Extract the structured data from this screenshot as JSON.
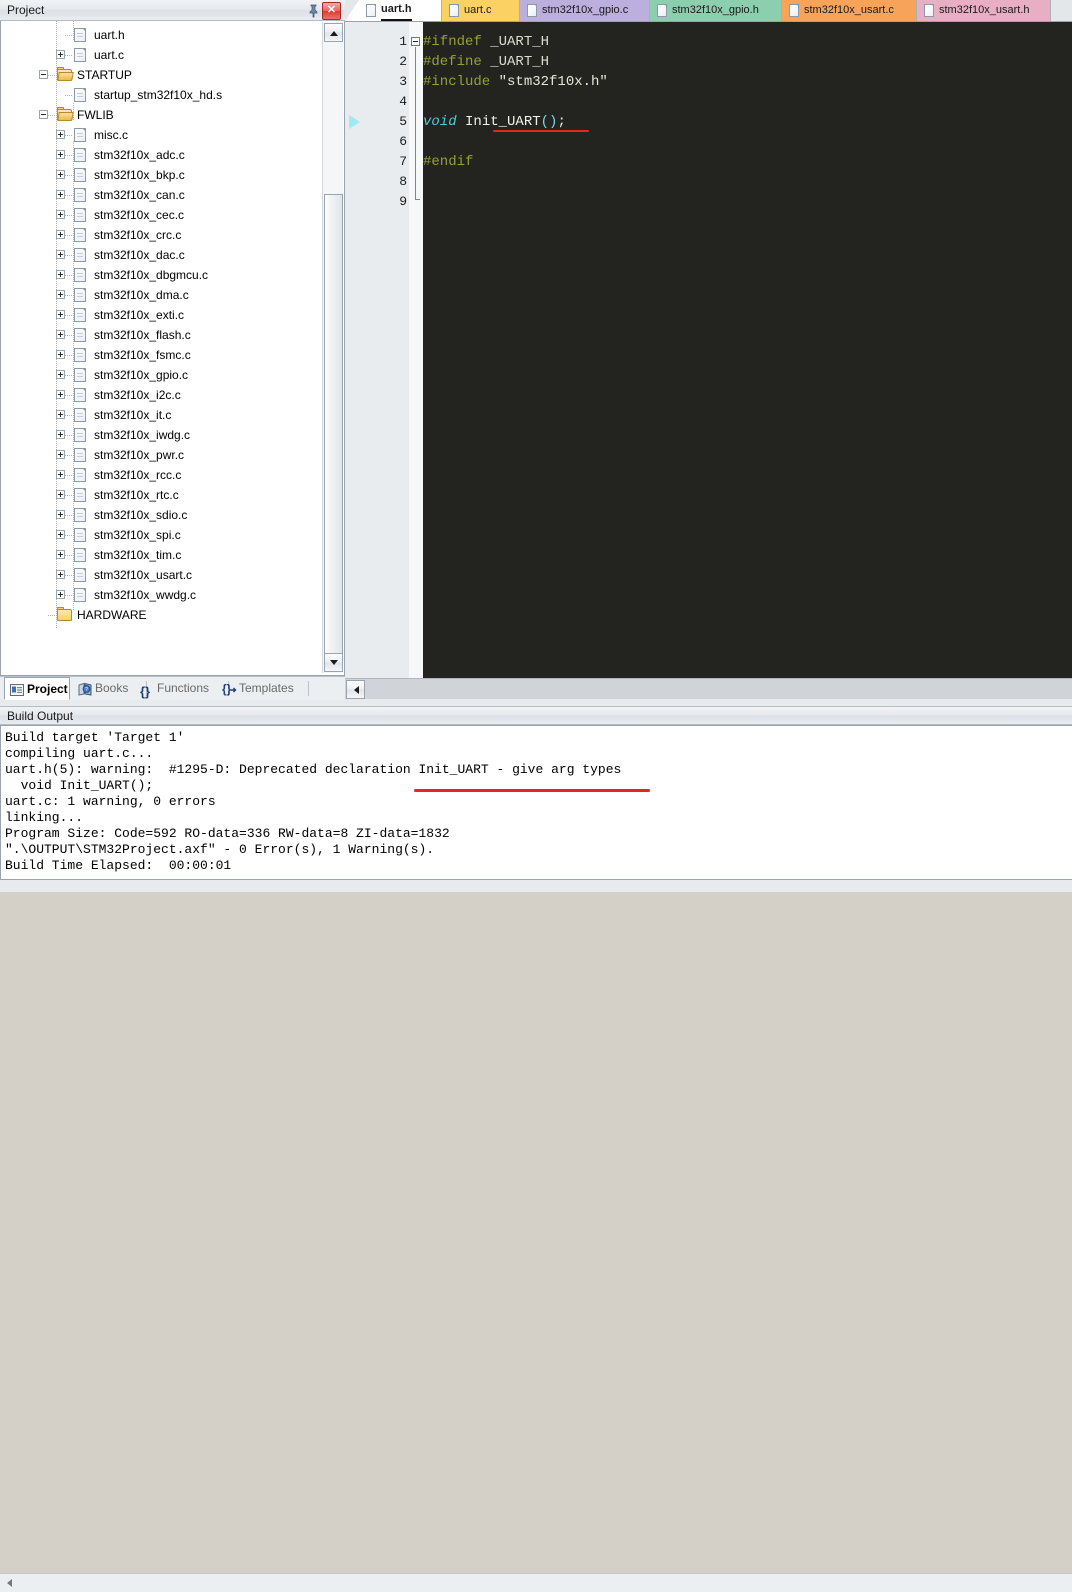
{
  "project_pane": {
    "title": "Project",
    "pin_icon": "pin-icon",
    "close_icon": "close-icon",
    "close_label": "✕",
    "tree": [
      {
        "label": "uart.h",
        "type": "file",
        "indent": 3,
        "expander": "none"
      },
      {
        "label": "uart.c",
        "type": "file",
        "indent": 3,
        "expander": "plus"
      },
      {
        "label": "STARTUP",
        "type": "folder-open",
        "indent": 2,
        "expander": "minus"
      },
      {
        "label": "startup_stm32f10x_hd.s",
        "type": "file",
        "indent": 3,
        "expander": "none"
      },
      {
        "label": "FWLIB",
        "type": "folder-open",
        "indent": 2,
        "expander": "minus"
      },
      {
        "label": "misc.c",
        "type": "file",
        "indent": 3,
        "expander": "plus"
      },
      {
        "label": "stm32f10x_adc.c",
        "type": "file",
        "indent": 3,
        "expander": "plus"
      },
      {
        "label": "stm32f10x_bkp.c",
        "type": "file",
        "indent": 3,
        "expander": "plus"
      },
      {
        "label": "stm32f10x_can.c",
        "type": "file",
        "indent": 3,
        "expander": "plus"
      },
      {
        "label": "stm32f10x_cec.c",
        "type": "file",
        "indent": 3,
        "expander": "plus"
      },
      {
        "label": "stm32f10x_crc.c",
        "type": "file",
        "indent": 3,
        "expander": "plus"
      },
      {
        "label": "stm32f10x_dac.c",
        "type": "file",
        "indent": 3,
        "expander": "plus"
      },
      {
        "label": "stm32f10x_dbgmcu.c",
        "type": "file",
        "indent": 3,
        "expander": "plus"
      },
      {
        "label": "stm32f10x_dma.c",
        "type": "file",
        "indent": 3,
        "expander": "plus"
      },
      {
        "label": "stm32f10x_exti.c",
        "type": "file",
        "indent": 3,
        "expander": "plus"
      },
      {
        "label": "stm32f10x_flash.c",
        "type": "file",
        "indent": 3,
        "expander": "plus"
      },
      {
        "label": "stm32f10x_fsmc.c",
        "type": "file",
        "indent": 3,
        "expander": "plus"
      },
      {
        "label": "stm32f10x_gpio.c",
        "type": "file",
        "indent": 3,
        "expander": "plus"
      },
      {
        "label": "stm32f10x_i2c.c",
        "type": "file",
        "indent": 3,
        "expander": "plus"
      },
      {
        "label": "stm32f10x_it.c",
        "type": "file",
        "indent": 3,
        "expander": "plus"
      },
      {
        "label": "stm32f10x_iwdg.c",
        "type": "file",
        "indent": 3,
        "expander": "plus"
      },
      {
        "label": "stm32f10x_pwr.c",
        "type": "file",
        "indent": 3,
        "expander": "plus"
      },
      {
        "label": "stm32f10x_rcc.c",
        "type": "file",
        "indent": 3,
        "expander": "plus"
      },
      {
        "label": "stm32f10x_rtc.c",
        "type": "file",
        "indent": 3,
        "expander": "plus"
      },
      {
        "label": "stm32f10x_sdio.c",
        "type": "file",
        "indent": 3,
        "expander": "plus"
      },
      {
        "label": "stm32f10x_spi.c",
        "type": "file",
        "indent": 3,
        "expander": "plus"
      },
      {
        "label": "stm32f10x_tim.c",
        "type": "file",
        "indent": 3,
        "expander": "plus"
      },
      {
        "label": "stm32f10x_usart.c",
        "type": "file",
        "indent": 3,
        "expander": "plus"
      },
      {
        "label": "stm32f10x_wwdg.c",
        "type": "file",
        "indent": 3,
        "expander": "plus"
      },
      {
        "label": "HARDWARE",
        "type": "folder",
        "indent": 2,
        "expander": "none"
      }
    ],
    "bottom_tabs": [
      {
        "label": "Project",
        "icon": "project-icon",
        "active": true
      },
      {
        "label": "Books",
        "icon": "books-icon",
        "active": false
      },
      {
        "label": "Functions",
        "icon": "braces-icon",
        "active": false
      },
      {
        "label": "Templates",
        "icon": "templates-icon",
        "active": false
      }
    ]
  },
  "editor": {
    "tabs": [
      {
        "label": "uart.h",
        "active": true,
        "color": "#ffffff"
      },
      {
        "label": "uart.c",
        "active": false,
        "color": "#fbd163"
      },
      {
        "label": "stm32f10x_gpio.c",
        "active": false,
        "color": "#bcaedd"
      },
      {
        "label": "stm32f10x_gpio.h",
        "active": false,
        "color": "#8ccfae"
      },
      {
        "label": "stm32f10x_usart.c",
        "active": false,
        "color": "#f7a45a"
      },
      {
        "label": "stm32f10x_usart.h",
        "active": false,
        "color": "#e8afc4"
      }
    ],
    "background": "#23241f",
    "line_numbers": [
      "1",
      "2",
      "3",
      "4",
      "5",
      "6",
      "7",
      "8",
      "9"
    ],
    "bookmark_line": 5,
    "fold_start_line": 1,
    "fold_end_line": 9,
    "code_lines": [
      {
        "n": 1,
        "tokens": [
          {
            "t": "#ifndef",
            "c": "pp"
          },
          {
            "t": " _UART_H",
            "c": "id"
          }
        ]
      },
      {
        "n": 2,
        "tokens": [
          {
            "t": "#define",
            "c": "pp"
          },
          {
            "t": " _UART_H",
            "c": "id"
          }
        ]
      },
      {
        "n": 3,
        "tokens": [
          {
            "t": "#include",
            "c": "pp"
          },
          {
            "t": " \"stm32f10x.h\"",
            "c": "str"
          }
        ]
      },
      {
        "n": 4,
        "tokens": []
      },
      {
        "n": 5,
        "tokens": [
          {
            "t": "void",
            "c": "kw"
          },
          {
            "t": " Init_UART",
            "c": "fn"
          },
          {
            "t": "()",
            "c": "paren"
          },
          {
            "t": ";",
            "c": "punct"
          }
        ]
      },
      {
        "n": 6,
        "tokens": []
      },
      {
        "n": 7,
        "tokens": [
          {
            "t": "#endif",
            "c": "pp"
          }
        ]
      },
      {
        "n": 8,
        "tokens": []
      },
      {
        "n": 9,
        "tokens": []
      }
    ],
    "annotation_color": "#e8241b"
  },
  "build_output": {
    "title": "Build Output",
    "lines": [
      "Build target 'Target 1'",
      "compiling uart.c...",
      "uart.h(5): warning:  #1295-D: Deprecated declaration Init_UART - give arg types",
      "  void Init_UART();",
      "uart.c: 1 warning, 0 errors",
      "linking...",
      "Program Size: Code=592 RO-data=336 RW-data=8 ZI-data=1832",
      "\".\\OUTPUT\\STM32Project.axf\" - 0 Error(s), 1 Warning(s).",
      "Build Time Elapsed:  00:00:01"
    ],
    "annotation_color": "#e8241b"
  }
}
